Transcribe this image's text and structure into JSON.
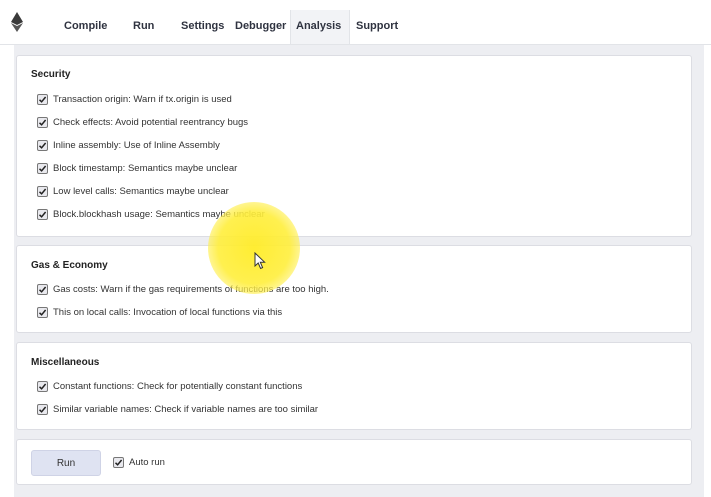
{
  "nav": {
    "tabs": [
      {
        "label": "Compile"
      },
      {
        "label": "Run"
      },
      {
        "label": "Settings"
      },
      {
        "label": "Debugger"
      },
      {
        "label": "Analysis",
        "active": true
      },
      {
        "label": "Support"
      }
    ]
  },
  "sections": {
    "security": {
      "title": "Security",
      "items": [
        {
          "label": "Transaction origin: Warn if tx.origin is used",
          "checked": true
        },
        {
          "label": "Check effects: Avoid potential reentrancy bugs",
          "checked": true
        },
        {
          "label": "Inline assembly: Use of Inline Assembly",
          "checked": true
        },
        {
          "label": "Block timestamp: Semantics maybe unclear",
          "checked": true
        },
        {
          "label": "Low level calls: Semantics maybe unclear",
          "checked": true
        },
        {
          "label": "Block.blockhash usage: Semantics maybe unclear",
          "checked": true
        }
      ]
    },
    "gas": {
      "title": "Gas & Economy",
      "items": [
        {
          "label": "Gas costs: Warn if the gas requirements of functions are too high.",
          "checked": true
        },
        {
          "label": "This on local calls: Invocation of local functions via this",
          "checked": true
        }
      ]
    },
    "misc": {
      "title": "Miscellaneous",
      "items": [
        {
          "label": "Constant functions: Check for potentially constant functions",
          "checked": true
        },
        {
          "label": "Similar variable names: Check if variable names are too similar",
          "checked": true
        }
      ]
    }
  },
  "footer": {
    "run_label": "Run",
    "auto_run_label": "Auto run",
    "auto_run_checked": true
  },
  "icons": {
    "logo": "ethereum-logo-icon",
    "checkbox_mark": "checkmark-icon",
    "cursor": "mouse-pointer-icon"
  },
  "colors": {
    "panel_bg": "#edeef2",
    "run_button_bg": "#dfe3f2",
    "cursor_highlight": "#ffec28"
  }
}
